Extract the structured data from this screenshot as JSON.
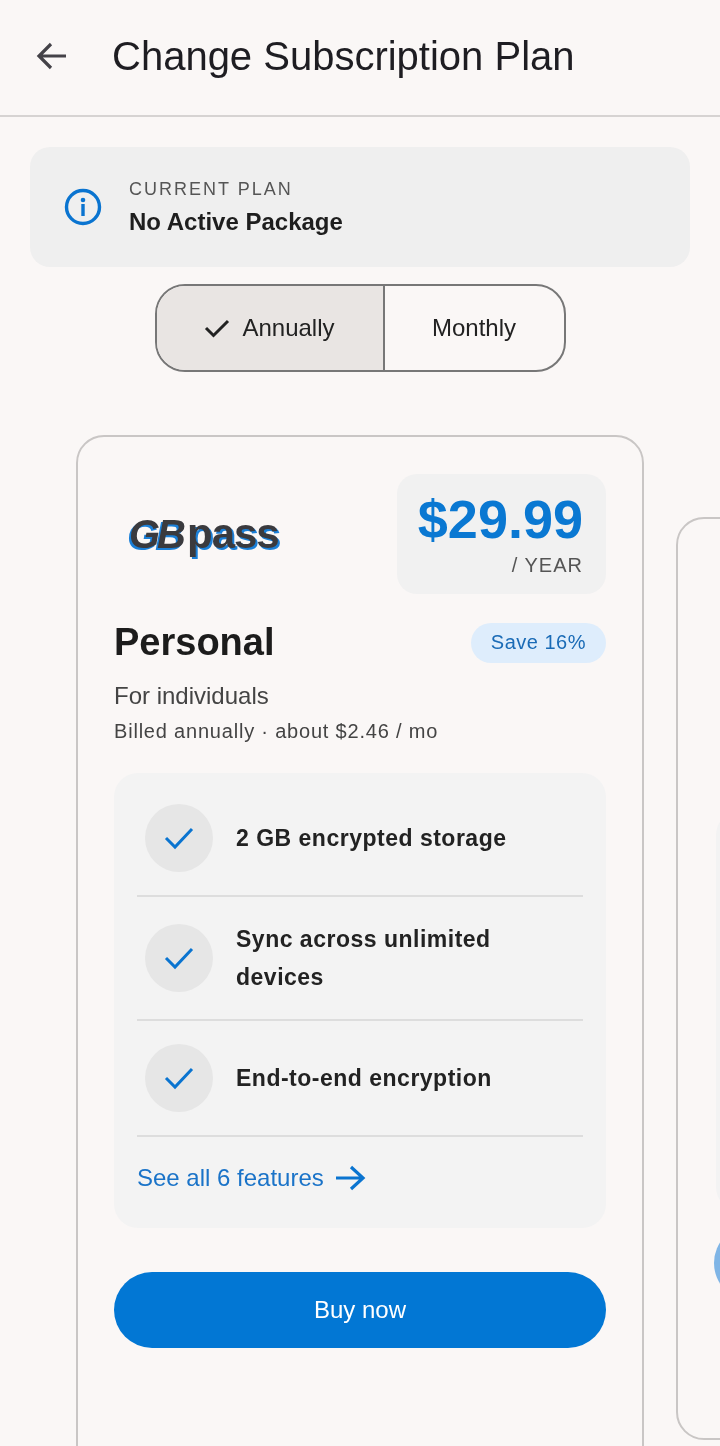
{
  "header": {
    "title": "Change Subscription Plan"
  },
  "current_plan": {
    "label": "CURRENT PLAN",
    "value": "No Active Package"
  },
  "billing_periods": [
    {
      "label": "Annually",
      "selected": true
    },
    {
      "label": "Monthly",
      "selected": false
    }
  ],
  "plans": [
    {
      "logo": {
        "mark": "GB",
        "word": "pass"
      },
      "price": "$29.99",
      "period": "/ YEAR",
      "name": "Personal",
      "badge": "Save 16%",
      "audience": "For individuals",
      "billing_note": "Billed annually · about $2.46 / mo",
      "features": [
        "2 GB encrypted storage",
        "Sync across unlimited devices",
        "End-to-end encryption"
      ],
      "see_all": "See all 6 features",
      "button": "Buy now"
    }
  ]
}
